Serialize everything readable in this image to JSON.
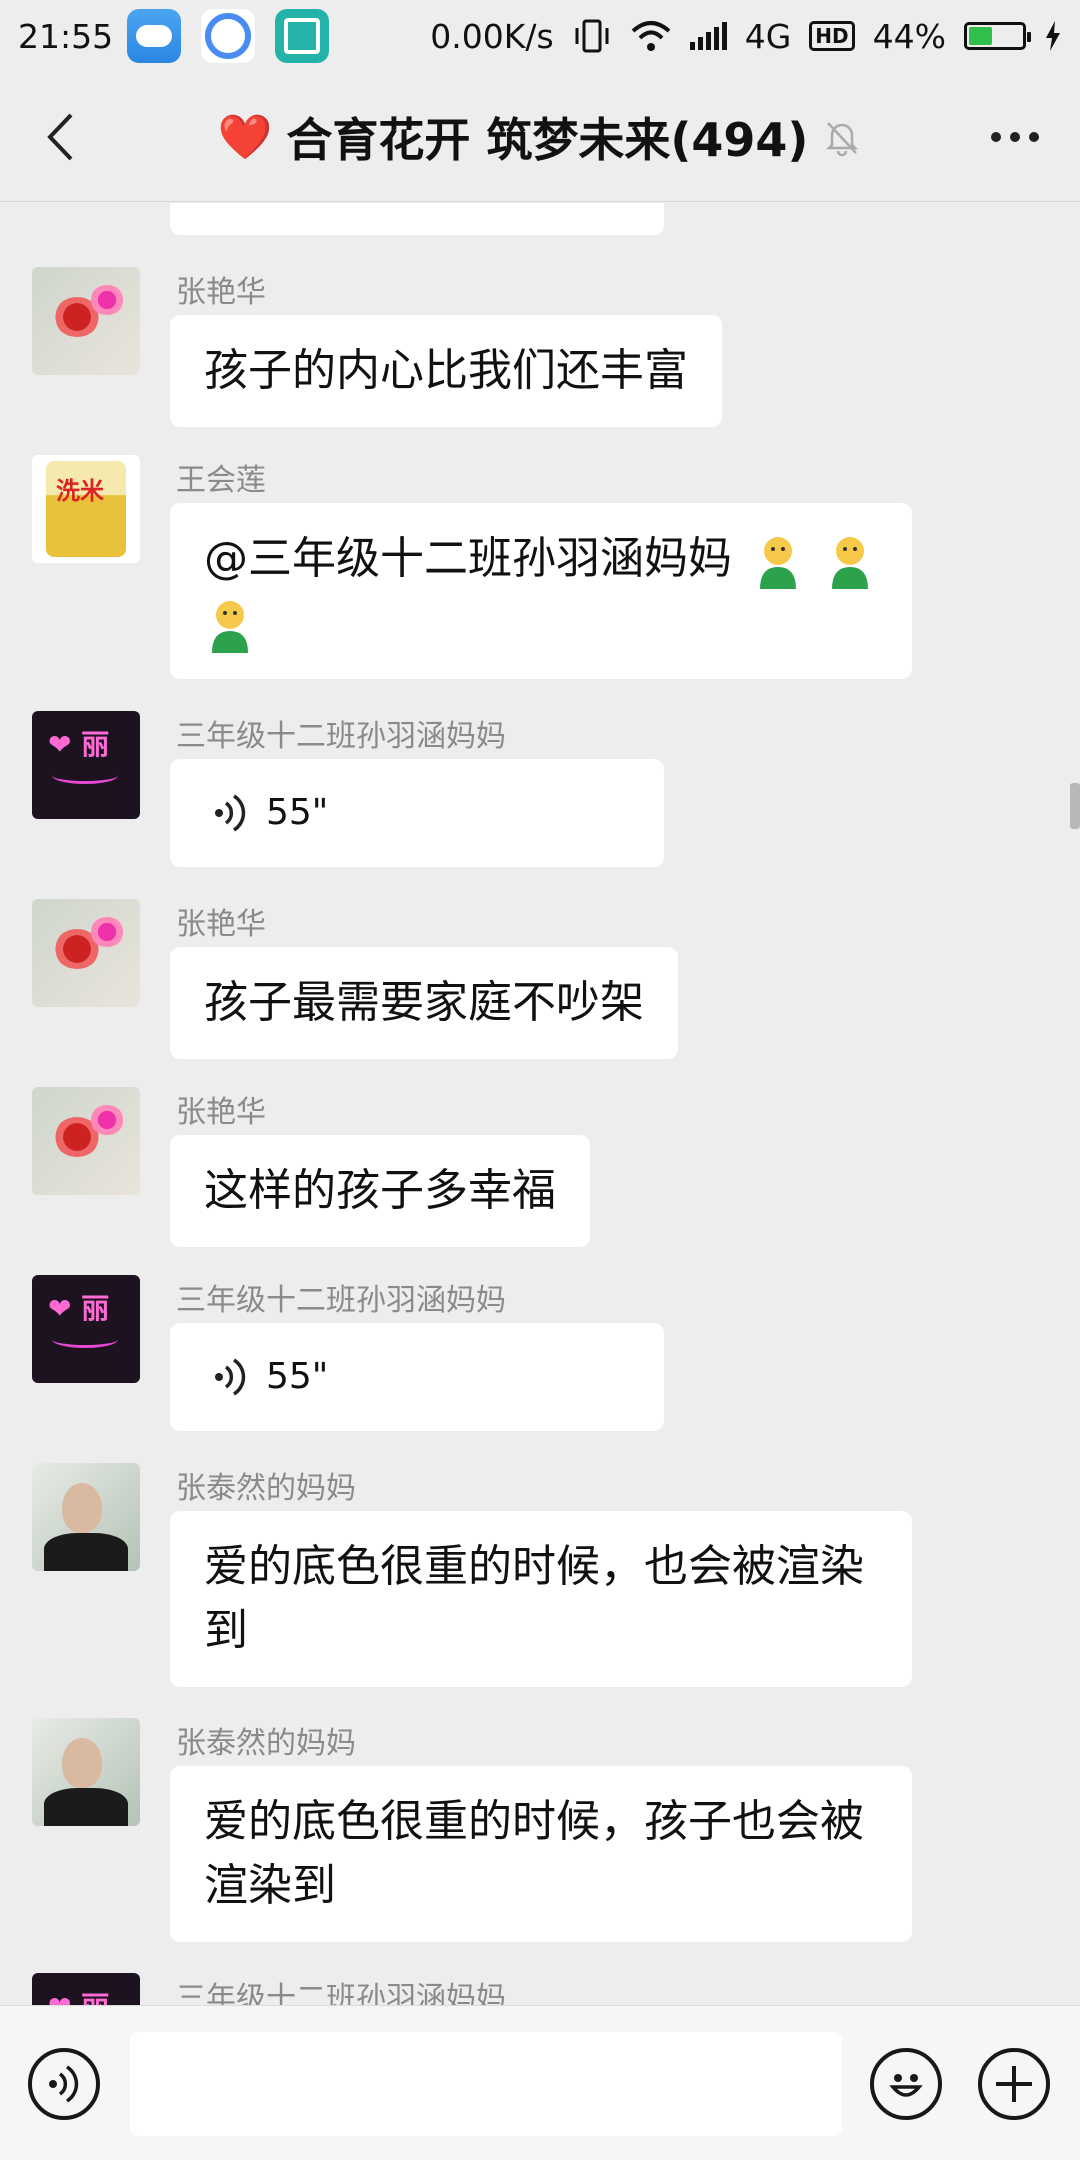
{
  "status_bar": {
    "time": "21:55",
    "speed": "0.00K/s",
    "network": "4G",
    "hd": "HD",
    "battery": "44%",
    "battery_level": 0.44,
    "app_icons": [
      "weather-icon",
      "browser-icon",
      "scan-icon"
    ]
  },
  "header": {
    "title": "合育花开 筑梦未来(494)",
    "heart": "❤️",
    "back_icon": "back-chevron-icon",
    "mute_icon": "bell-muted-icon",
    "more_icon": "more-dots-icon"
  },
  "messages": [
    {
      "sender": "张艳华",
      "avatar": "flower-avatar",
      "type": "text",
      "text": "孩子的内心比我们还丰富"
    },
    {
      "sender": "王会莲",
      "avatar": "rice-bag-avatar",
      "type": "text",
      "text": "@三年级十二班孙羽涵妈妈",
      "emoji_count": 3
    },
    {
      "sender": "三年级十二班孙羽涵妈妈",
      "avatar": "neon-avatar",
      "type": "voice",
      "duration": "55\""
    },
    {
      "sender": "张艳华",
      "avatar": "flower-avatar",
      "type": "text",
      "text": "孩子最需要家庭不吵架"
    },
    {
      "sender": "张艳华",
      "avatar": "flower-avatar",
      "type": "text",
      "text": "这样的孩子多幸福"
    },
    {
      "sender": "三年级十二班孙羽涵妈妈",
      "avatar": "neon-avatar",
      "type": "voice",
      "duration": "55\""
    },
    {
      "sender": "张泰然的妈妈",
      "avatar": "woman-avatar",
      "type": "text",
      "text": "爱的底色很重的时候，也会被渲染到"
    },
    {
      "sender": "张泰然的妈妈",
      "avatar": "woman-avatar",
      "type": "text",
      "text": "爱的底色很重的时候，孩子也会被渲染到"
    },
    {
      "sender": "三年级十二班孙羽涵妈妈",
      "avatar": "neon-avatar",
      "type": "partial"
    }
  ],
  "input_bar": {
    "voice_icon": "voice-input-icon",
    "emoji_icon": "smiley-icon",
    "plus_icon": "plus-icon",
    "placeholder": ""
  }
}
